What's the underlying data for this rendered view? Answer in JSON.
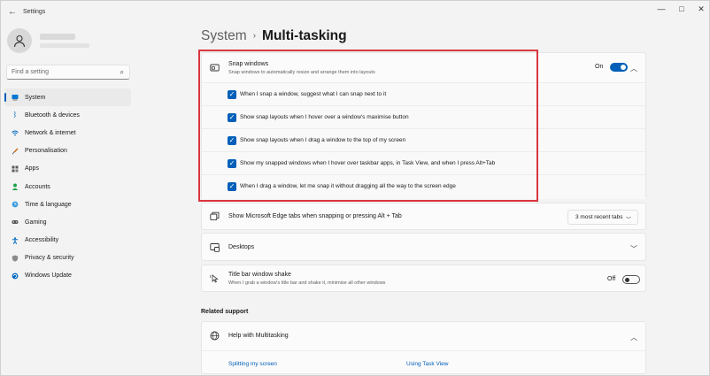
{
  "window": {
    "title": "Settings",
    "back_glyph": "←",
    "minimize_glyph": "—",
    "maximize_glyph": "□",
    "close_glyph": "✕"
  },
  "search": {
    "placeholder": "Find a setting",
    "icon": "search-icon"
  },
  "sidebar": {
    "items": [
      {
        "label": "System",
        "icon": "laptop-icon",
        "color": "#0078d4",
        "active": true
      },
      {
        "label": "Bluetooth & devices",
        "icon": "bluetooth-icon",
        "color": "#0067c0"
      },
      {
        "label": "Network & internet",
        "icon": "wifi-icon",
        "color": "#0067c0"
      },
      {
        "label": "Personalisation",
        "icon": "brush-icon",
        "color": "#c2670c"
      },
      {
        "label": "Apps",
        "icon": "apps-icon",
        "color": "#5a5a5a"
      },
      {
        "label": "Accounts",
        "icon": "person-icon",
        "color": "#1aa34a"
      },
      {
        "label": "Time & language",
        "icon": "globe-clock-icon",
        "color": "#0067c0"
      },
      {
        "label": "Gaming",
        "icon": "gamepad-icon",
        "color": "#5a5a5a"
      },
      {
        "label": "Accessibility",
        "icon": "accessibility-icon",
        "color": "#0067c0"
      },
      {
        "label": "Privacy & security",
        "icon": "shield-icon",
        "color": "#7a7a7a"
      },
      {
        "label": "Windows Update",
        "icon": "update-icon",
        "color": "#0067c0"
      }
    ]
  },
  "breadcrumb": {
    "parent": "System",
    "separator": "›",
    "current": "Multi-tasking"
  },
  "snap": {
    "title": "Snap windows",
    "subtitle": "Snap windows to automatically resize and arrange them into layouts",
    "toggle_label": "On",
    "toggle_on": true,
    "options": [
      {
        "label": "When I snap a window, suggest what I can snap next to it",
        "checked": true
      },
      {
        "label": "Show snap layouts when I hover over a window's maximise button",
        "checked": true
      },
      {
        "label": "Show snap layouts when I drag a window to the top of my screen",
        "checked": true
      },
      {
        "label": "Show my snapped windows when I hover over taskbar apps, in Task View, and when I press Alt+Tab",
        "checked": true
      },
      {
        "label": "When I drag a window, let me snap it without dragging all the way to the screen edge",
        "checked": true
      }
    ]
  },
  "edge_tabs": {
    "title": "Show Microsoft Edge tabs when snapping or pressing Alt + Tab",
    "selected": "3 most recent tabs"
  },
  "desktops": {
    "title": "Desktops"
  },
  "shake": {
    "title": "Title bar window shake",
    "subtitle": "When I grab a window's title bar and shake it, minimise all other windows",
    "toggle_label": "Off",
    "toggle_on": false
  },
  "support": {
    "heading": "Related support",
    "title": "Help with Multitasking",
    "links": [
      "Splitting my screen",
      "Using Task View"
    ]
  },
  "colors": {
    "accent": "#005fb8",
    "highlight_border": "#d9363e"
  }
}
